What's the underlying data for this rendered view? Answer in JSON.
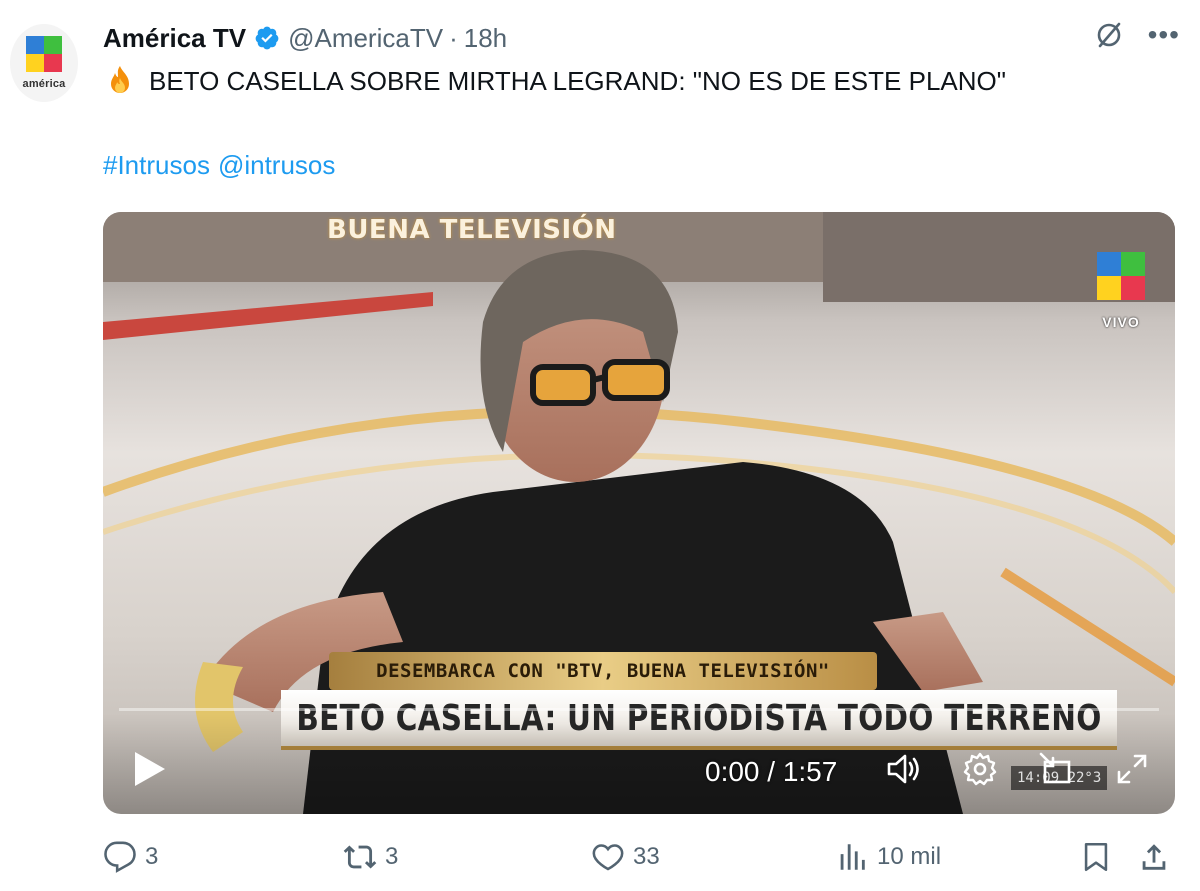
{
  "author": {
    "name": "América TV",
    "handle": "@AmericaTV",
    "separator": "·",
    "time": "18h",
    "avatar_text": "américa",
    "verified": true
  },
  "tweet": {
    "emoji_icon": "fire-icon",
    "text": "BETO CASELLA SOBRE MIRTHA LEGRAND: \"NO ES DE ESTE PLANO\"",
    "hashtag": "#Intrusos",
    "mention": "@intrusos"
  },
  "video": {
    "banner_top": "BUENA TELEVISIÓN",
    "channel_live": "VIVO",
    "lower_third_sub": "DESEMBARCA CON \"BTV, BUENA TELEVISIÓN\"",
    "lower_third_main": "BETO CASELLA: UN PERIODISTA TODO TERRENO",
    "time_readout": "0:00 / 1:57",
    "clock_overlay": "14:09 22°3",
    "progress": 0
  },
  "actions": {
    "replies": "3",
    "retweets": "3",
    "likes": "33",
    "views": "10 mil"
  },
  "colors": {
    "accent": "#1d9bf0",
    "muted": "#536471",
    "text": "#0f1419",
    "logo_blue": "#2f7fd6",
    "logo_green": "#3fbf3f",
    "logo_yellow": "#ffd21f",
    "logo_red": "#e8384f"
  }
}
